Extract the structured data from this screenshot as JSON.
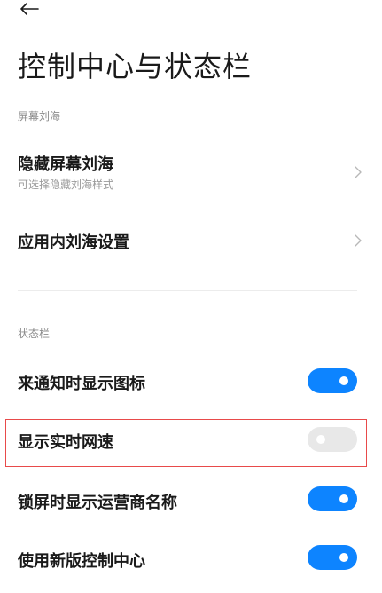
{
  "header": {
    "back_icon": "arrow-left-icon",
    "title": "控制中心与状态栏"
  },
  "sections": {
    "notch": {
      "label": "屏幕刘海",
      "items": [
        {
          "title": "隐藏屏幕刘海",
          "subtitle": "可选择隐藏刘海样式"
        },
        {
          "title": "应用内刘海设置"
        }
      ]
    },
    "status_bar": {
      "label": "状态栏",
      "items": [
        {
          "title": "来通知时显示图标",
          "enabled": true
        },
        {
          "title": "显示实时网速",
          "enabled": false
        },
        {
          "title": "锁屏时显示运营商名称",
          "enabled": true
        },
        {
          "title": "使用新版控制中心",
          "enabled": true
        }
      ]
    }
  },
  "colors": {
    "toggle_on": "#0d84ff",
    "toggle_off": "#e8e8e8",
    "highlight_border": "#e84a4a"
  }
}
